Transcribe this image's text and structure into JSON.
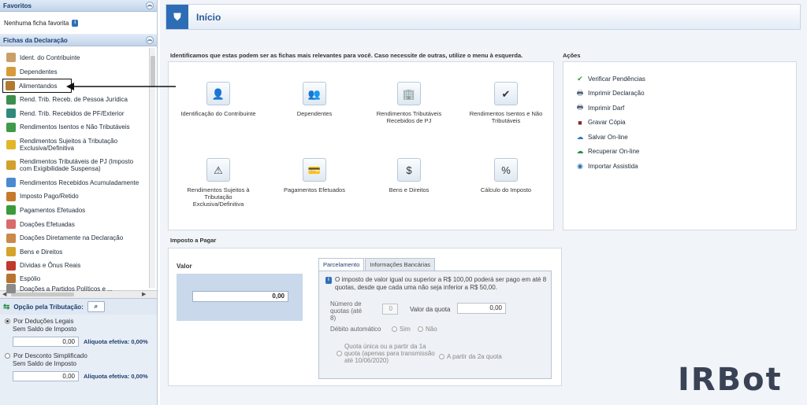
{
  "sidebar": {
    "favoritos": {
      "title": "Favoritos",
      "empty_text": "Nenhuma ficha favorita"
    },
    "fichas": {
      "title": "Fichas da Declaração",
      "items": [
        {
          "label": "Ident. do Contribuinte",
          "icon": "person-icon",
          "color": "#c9a06a"
        },
        {
          "label": "Dependentes",
          "icon": "dependents-icon",
          "color": "#d99a3a"
        },
        {
          "label": "Alimentandos",
          "icon": "alimentandos-icon",
          "color": "#b37a2f"
        },
        {
          "label": "Rend. Trib. Receb. de Pessoa Jurídica",
          "icon": "income-pj-icon",
          "color": "#3b8f4c"
        },
        {
          "label": "Rend. Trib. Recebidos de PF/Exterior",
          "icon": "income-pf-icon",
          "color": "#2f8a7a"
        },
        {
          "label": "Rendimentos Isentos e Não Tributáveis",
          "icon": "exempt-icon",
          "color": "#3f9a4a"
        },
        {
          "label": "Rendimentos Sujeitos à Tributação Exclusiva/Definitiva",
          "icon": "warning-doc-icon",
          "color": "#e2b629"
        },
        {
          "label": "Rendimentos Tributáveis de PJ (Imposto com Exigibilidade Suspensa)",
          "icon": "suspended-icon",
          "color": "#d2a12b"
        },
        {
          "label": "Rendimentos Recebidos Acumuladamente",
          "icon": "accumulated-icon",
          "color": "#4a8ad0"
        },
        {
          "label": "Imposto Pago/Retido",
          "icon": "tax-paid-icon",
          "color": "#c57a2a"
        },
        {
          "label": "Pagamentos Efetuados",
          "icon": "payments-icon",
          "color": "#3a9a3a"
        },
        {
          "label": "Doações Efetuadas",
          "icon": "donations-icon",
          "color": "#d86b6b"
        },
        {
          "label": "Doações Diretamente na Declaração",
          "icon": "direct-donations-icon",
          "color": "#c98a4a"
        },
        {
          "label": "Bens e Direitos",
          "icon": "assets-icon",
          "color": "#d4a52a"
        },
        {
          "label": "Dívidas e Ônus Reais",
          "icon": "debts-icon",
          "color": "#c0392b"
        },
        {
          "label": "Espólio",
          "icon": "estate-icon",
          "color": "#b8742f"
        },
        {
          "label": "Doações a Partidos Políticos e ...",
          "icon": "party-donations-icon",
          "color": "#8a8a8a"
        }
      ]
    },
    "opcao": {
      "title": "Opção pela Tributação:",
      "deducoes_label": "Por Deduções Legais",
      "sem_saldo_1": "Sem Saldo de Imposto",
      "value_1": "0,00",
      "aliquota_1": "Alíquota efetiva: 0,00%",
      "simplificado_label": "Por Desconto Simplificado",
      "sem_saldo_2": "Sem Saldo de Imposto",
      "value_2": "0,00",
      "aliquota_2": "Alíquota efetiva: 0,00%"
    }
  },
  "main": {
    "title": "Início",
    "intro": "Identificamos que estas podem ser as fichas mais relevantes para você. Caso necessite de outras, utilize o menu à esquerda.",
    "tiles": [
      {
        "label": "Identificação do Contribuinte",
        "glyph": "👤"
      },
      {
        "label": "Dependentes",
        "glyph": "👥"
      },
      {
        "label": "Rendimentos Tributáveis Recebidos de PJ",
        "glyph": "🏢"
      },
      {
        "label": "Rendimentos Isentos e Não Tributáveis",
        "glyph": "✔"
      },
      {
        "label": "Rendimentos Sujeitos à Tributação Exclusiva/Definitiva",
        "glyph": "⚠"
      },
      {
        "label": "Pagamentos Efetuados",
        "glyph": "💳"
      },
      {
        "label": "Bens e Direitos",
        "glyph": "$"
      },
      {
        "label": "Cálculo do Imposto",
        "glyph": "%"
      }
    ],
    "acoes": {
      "title": "Ações",
      "items": [
        {
          "label": "Verificar Pendências",
          "glyph": "✔",
          "color": "#2e9a2e"
        },
        {
          "label": "Imprimir Declaração",
          "glyph": "🖶",
          "color": "#4a5a70"
        },
        {
          "label": "Imprimir Darf",
          "glyph": "🖶",
          "color": "#4a5a70"
        },
        {
          "label": "Gravar Cópia",
          "glyph": "■",
          "color": "#8a2a2a"
        },
        {
          "label": "Salvar On-line",
          "glyph": "☁",
          "color": "#3a7ac0"
        },
        {
          "label": "Recuperar On-line",
          "glyph": "☁",
          "color": "#2e8a4a"
        },
        {
          "label": "Importar Assistida",
          "glyph": "◉",
          "color": "#2d6db5"
        }
      ]
    },
    "imposto": {
      "title": "Imposto a Pagar",
      "valor_label": "Valor",
      "valor": "0,00",
      "tabs": [
        "Parcelamento",
        "Informações Bancárias"
      ],
      "info_text": "O imposto de valor igual ou superior a R$ 100,00 poderá ser pago em até 8 quotas, desde que cada uma não seja inferior a R$ 50,00.",
      "numero_quotas_label": "Número de quotas (até 8)",
      "numero_quotas_value": "0",
      "valor_quota_label": "Valor da quota",
      "valor_quota_value": "0,00",
      "debito_label": "Débito automático",
      "sim": "Sim",
      "nao": "Não",
      "quota_unica_label": "Quota única ou a partir da 1a quota (apenas para transmissão até 10/06/2020)",
      "segunda_quota_label": "A partir da 2a quota"
    }
  },
  "brand": {
    "watermark": "IRBot"
  }
}
